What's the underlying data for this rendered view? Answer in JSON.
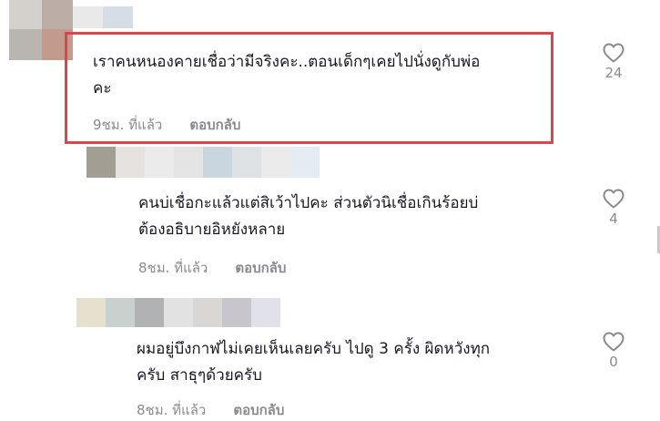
{
  "comments": [
    {
      "text": "เราคนหนองคายเชื่อว่ามีจริงคะ..ตอนเด็กๆเคยไปนั่งดูกับพ่อ\nคะ",
      "time": "9ชม. ที่แล้ว",
      "reply_label": "ตอบกลับ",
      "likes": "24",
      "highlighted": true
    },
    {
      "text": "คนบ่เชื่อกะแล้วแต่สิเว้าไปคะ ส่วนตัวนิเชื่อเกินร้อยบ่\nต้องอธิบายอิหยังหลาย",
      "time": "8ชม. ที่แล้ว",
      "reply_label": "ตอบกลับ",
      "likes": "4"
    },
    {
      "text": "ผมอยู่บึงกาฬไม่เคยเห็นเลยครับ ไปดู 3 ครั้ง ผิดหวังทุก\nครับ สาธุๆด้วยครับ",
      "time": "8ชม. ที่แล้ว",
      "reply_label": "ตอบกลับ",
      "likes": "0"
    }
  ],
  "colors": {
    "highlight_border": "#e0434b",
    "secondary_text": "#8a8b91",
    "primary_text": "#161823"
  },
  "icons": {
    "like": "heart-outline-icon",
    "avatar": "blurred-avatar"
  }
}
